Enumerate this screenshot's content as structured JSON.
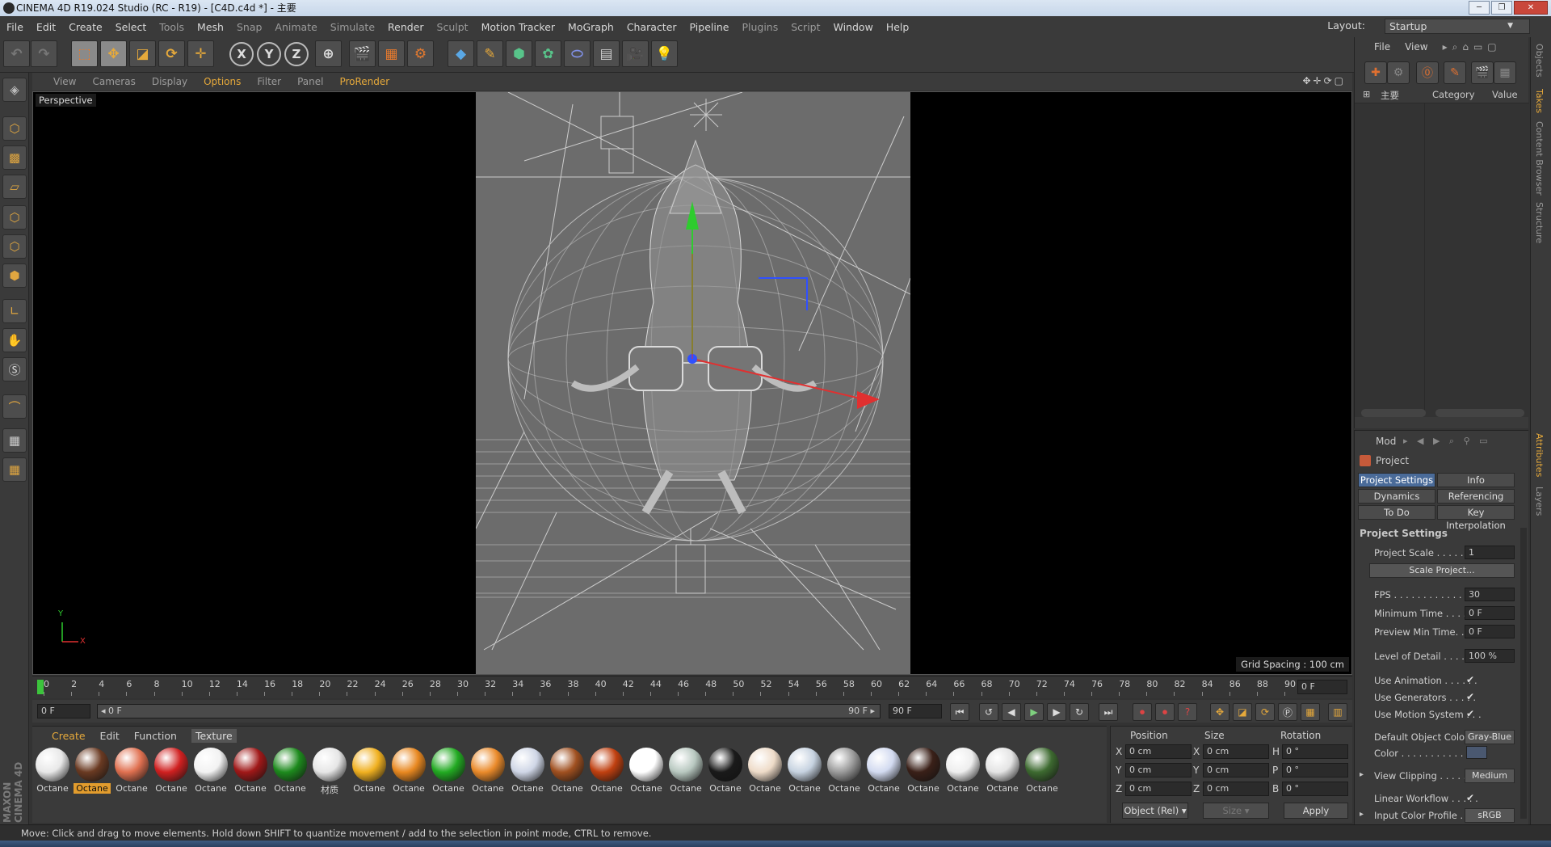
{
  "window": {
    "title": "CINEMA 4D R19.024 Studio (RC - R19) - [C4D.c4d *] - 主要"
  },
  "menu": [
    {
      "label": "File"
    },
    {
      "label": "Edit"
    },
    {
      "label": "Create"
    },
    {
      "label": "Select"
    },
    {
      "label": "Tools",
      "dim": true
    },
    {
      "label": "Mesh"
    },
    {
      "label": "Snap",
      "dim": true
    },
    {
      "label": "Animate",
      "dim": true
    },
    {
      "label": "Simulate",
      "dim": true
    },
    {
      "label": "Render"
    },
    {
      "label": "Sculpt",
      "dim": true
    },
    {
      "label": "Motion Tracker"
    },
    {
      "label": "MoGraph"
    },
    {
      "label": "Character"
    },
    {
      "label": "Pipeline"
    },
    {
      "label": "Plugins",
      "dim": true
    },
    {
      "label": "Script",
      "dim": true
    },
    {
      "label": "Window"
    },
    {
      "label": "Help"
    }
  ],
  "layout": {
    "label": "Layout:",
    "value": "Startup"
  },
  "toolbar": {
    "x": "X",
    "y": "Y",
    "z": "Z"
  },
  "viewport": {
    "menu": [
      "View",
      "Cameras",
      "Display",
      "Options",
      "Filter",
      "Panel",
      "ProRender"
    ],
    "highlight": [
      "Options",
      "ProRender"
    ],
    "camera_label": "Perspective",
    "grid_spacing": "Grid Spacing : 100 cm",
    "axis_y": "Y",
    "axis_x": "X"
  },
  "timeline": {
    "ticks": [
      "0",
      "2",
      "4",
      "6",
      "8",
      "10",
      "12",
      "14",
      "16",
      "18",
      "20",
      "22",
      "24",
      "26",
      "28",
      "30",
      "32",
      "34",
      "36",
      "38",
      "40",
      "42",
      "44",
      "46",
      "48",
      "50",
      "52",
      "54",
      "56",
      "58",
      "60",
      "62",
      "64",
      "66",
      "68",
      "70",
      "72",
      "74",
      "76",
      "78",
      "80",
      "82",
      "84",
      "86",
      "88",
      "90"
    ],
    "end_field": "0 F"
  },
  "playback": {
    "current": "0 F",
    "range_start": "◂ 0 F",
    "range_end": "90 F ▸",
    "max": "90 F"
  },
  "materials": {
    "menu": [
      "Create",
      "Edit",
      "Function",
      "Texture"
    ],
    "items": [
      {
        "label": "Octane",
        "color": "#e8e8e8"
      },
      {
        "label": "Octane",
        "color": "#6a3a22",
        "selected": true
      },
      {
        "label": "Octane",
        "color": "#e07050"
      },
      {
        "label": "Octane",
        "color": "#d02020"
      },
      {
        "label": "Octane",
        "color": "#f2f2f2"
      },
      {
        "label": "Octane",
        "color": "#a01818"
      },
      {
        "label": "Octane",
        "color": "#1d8a1d"
      },
      {
        "label": "材质",
        "color": "#e6e6e6"
      },
      {
        "label": "Octane",
        "color": "#f0b020"
      },
      {
        "label": "Octane",
        "color": "#e88820"
      },
      {
        "label": "Octane",
        "color": "#22aa22"
      },
      {
        "label": "Octane",
        "color": "#ea8a2a"
      },
      {
        "label": "Octane",
        "color": "#cfd6e6"
      },
      {
        "label": "Octane",
        "color": "#a05020"
      },
      {
        "label": "Octane",
        "color": "#c04010"
      },
      {
        "label": "Octane",
        "color": "#ffffff"
      },
      {
        "label": "Octane",
        "color": "#b8c8c0"
      },
      {
        "label": "Octane",
        "color": "#1a1a1a"
      },
      {
        "label": "Octane",
        "color": "#eedbc8"
      },
      {
        "label": "Octane",
        "color": "#c6d2e0"
      },
      {
        "label": "Octane",
        "color": "#9a9a9a"
      },
      {
        "label": "Octane",
        "color": "#d2daf0"
      },
      {
        "label": "Octane",
        "color": "#3a2018"
      },
      {
        "label": "Octane",
        "color": "#eeeeee"
      },
      {
        "label": "Octane",
        "color": "#e4e4e4"
      },
      {
        "label": "Octane",
        "color": "#3d6a30"
      }
    ]
  },
  "coords": {
    "headers": {
      "position": "Position",
      "size": "Size",
      "rotation": "Rotation"
    },
    "rows": [
      {
        "pl": "X",
        "pv": "0 cm",
        "sl": "X",
        "sv": "0 cm",
        "rl": "H",
        "rv": "0 °"
      },
      {
        "pl": "Y",
        "pv": "0 cm",
        "sl": "Y",
        "sv": "0 cm",
        "rl": "P",
        "rv": "0 °"
      },
      {
        "pl": "Z",
        "pv": "0 cm",
        "sl": "Z",
        "sv": "0 cm",
        "rl": "B",
        "rv": "0 °"
      }
    ],
    "mode": "Object (Rel)",
    "size_mode": "Size",
    "apply": "Apply"
  },
  "objects": {
    "menu": [
      "File",
      "View"
    ],
    "col_name": "主要",
    "col_category": "Category",
    "col_value": "Value"
  },
  "attributes": {
    "menu": "Mod",
    "object_name": "Project",
    "tabs": [
      "Project Settings",
      "Info",
      "Dynamics",
      "Referencing",
      "To Do",
      "Key Interpolation"
    ],
    "section": "Project Settings",
    "fields": {
      "project_scale": {
        "label": "Project Scale . . . . . . . .",
        "value": "1"
      },
      "scale_project": "Scale Project...",
      "fps": {
        "label": "FPS . . . . . . . . . . . . . . . .",
        "value": "30"
      },
      "min_time": {
        "label": "Minimum Time . . . . . .",
        "value": "0 F"
      },
      "preview_min": {
        "label": "Preview Min Time. . . .",
        "value": "0 F"
      },
      "lod": {
        "label": "Level of Detail . . . . . .",
        "value": "100 %"
      },
      "use_animation": {
        "label": "Use Animation . . . . . .",
        "value": "✔"
      },
      "use_generators": {
        "label": "Use Generators . . . . .",
        "value": "✔"
      },
      "use_motion": {
        "label": "Use Motion System . . .",
        "value": "✔"
      },
      "default_color": {
        "label": "Default Object Color",
        "value": "Gray-Blue"
      },
      "color": {
        "label": "Color . . . . . . . . . . . . ."
      },
      "view_clipping": {
        "label": "View Clipping . . . . . . .",
        "value": "Medium"
      },
      "linear_workflow": {
        "label": "Linear Workflow . . . . .",
        "value": "✔"
      },
      "input_color": {
        "label": "Input Color Profile . . .",
        "value": "sRGB"
      }
    }
  },
  "sidetabs": [
    "Objects",
    "Takes",
    "Content Browser",
    "Structure",
    "Attributes",
    "Layers"
  ],
  "status": "Move: Click and drag to move elements. Hold down SHIFT to quantize movement / add to the selection in point mode, CTRL to remove.",
  "logo": "MAXON CINEMA 4D"
}
